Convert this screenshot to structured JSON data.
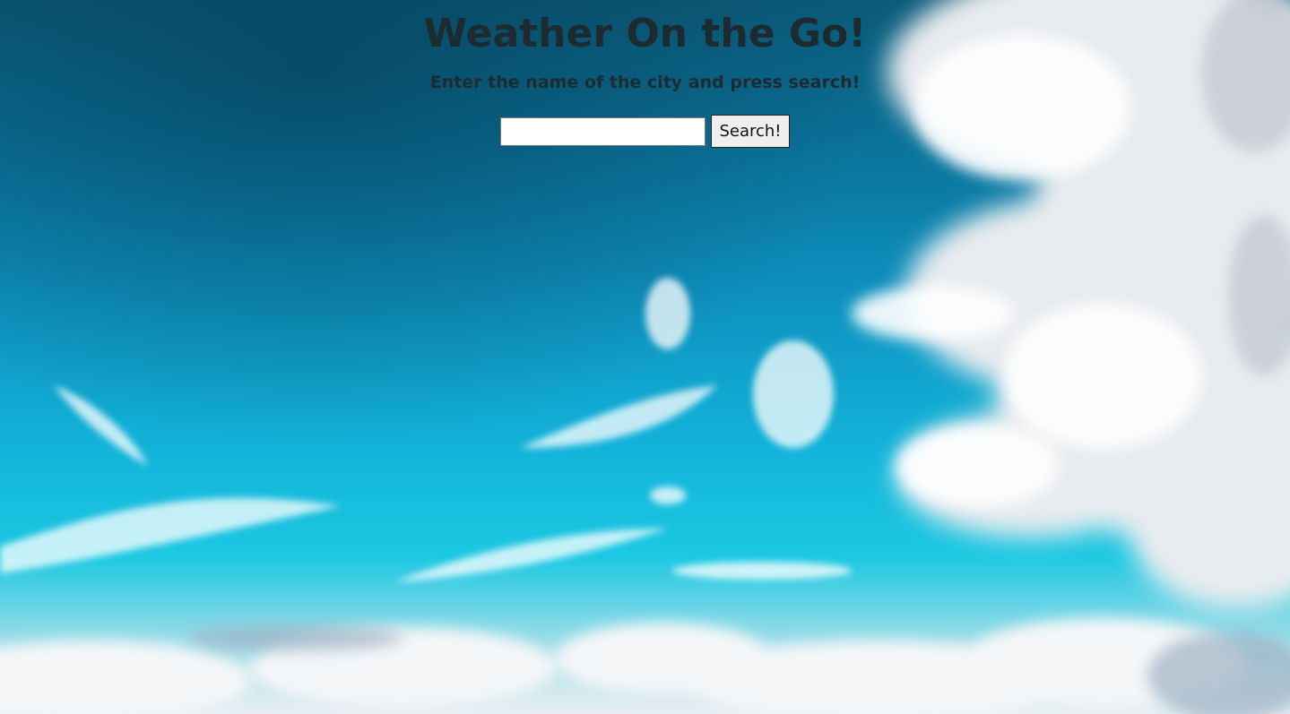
{
  "header": {
    "title": "Weather On the Go!",
    "subtitle": "Enter the name of the city and press search!"
  },
  "search": {
    "value": "",
    "placeholder": "",
    "button_label": "Search!"
  },
  "colors": {
    "heading_text": "#1d2a30",
    "sky_top": "#0b5a78",
    "sky_bottom": "#1cc8e2"
  }
}
